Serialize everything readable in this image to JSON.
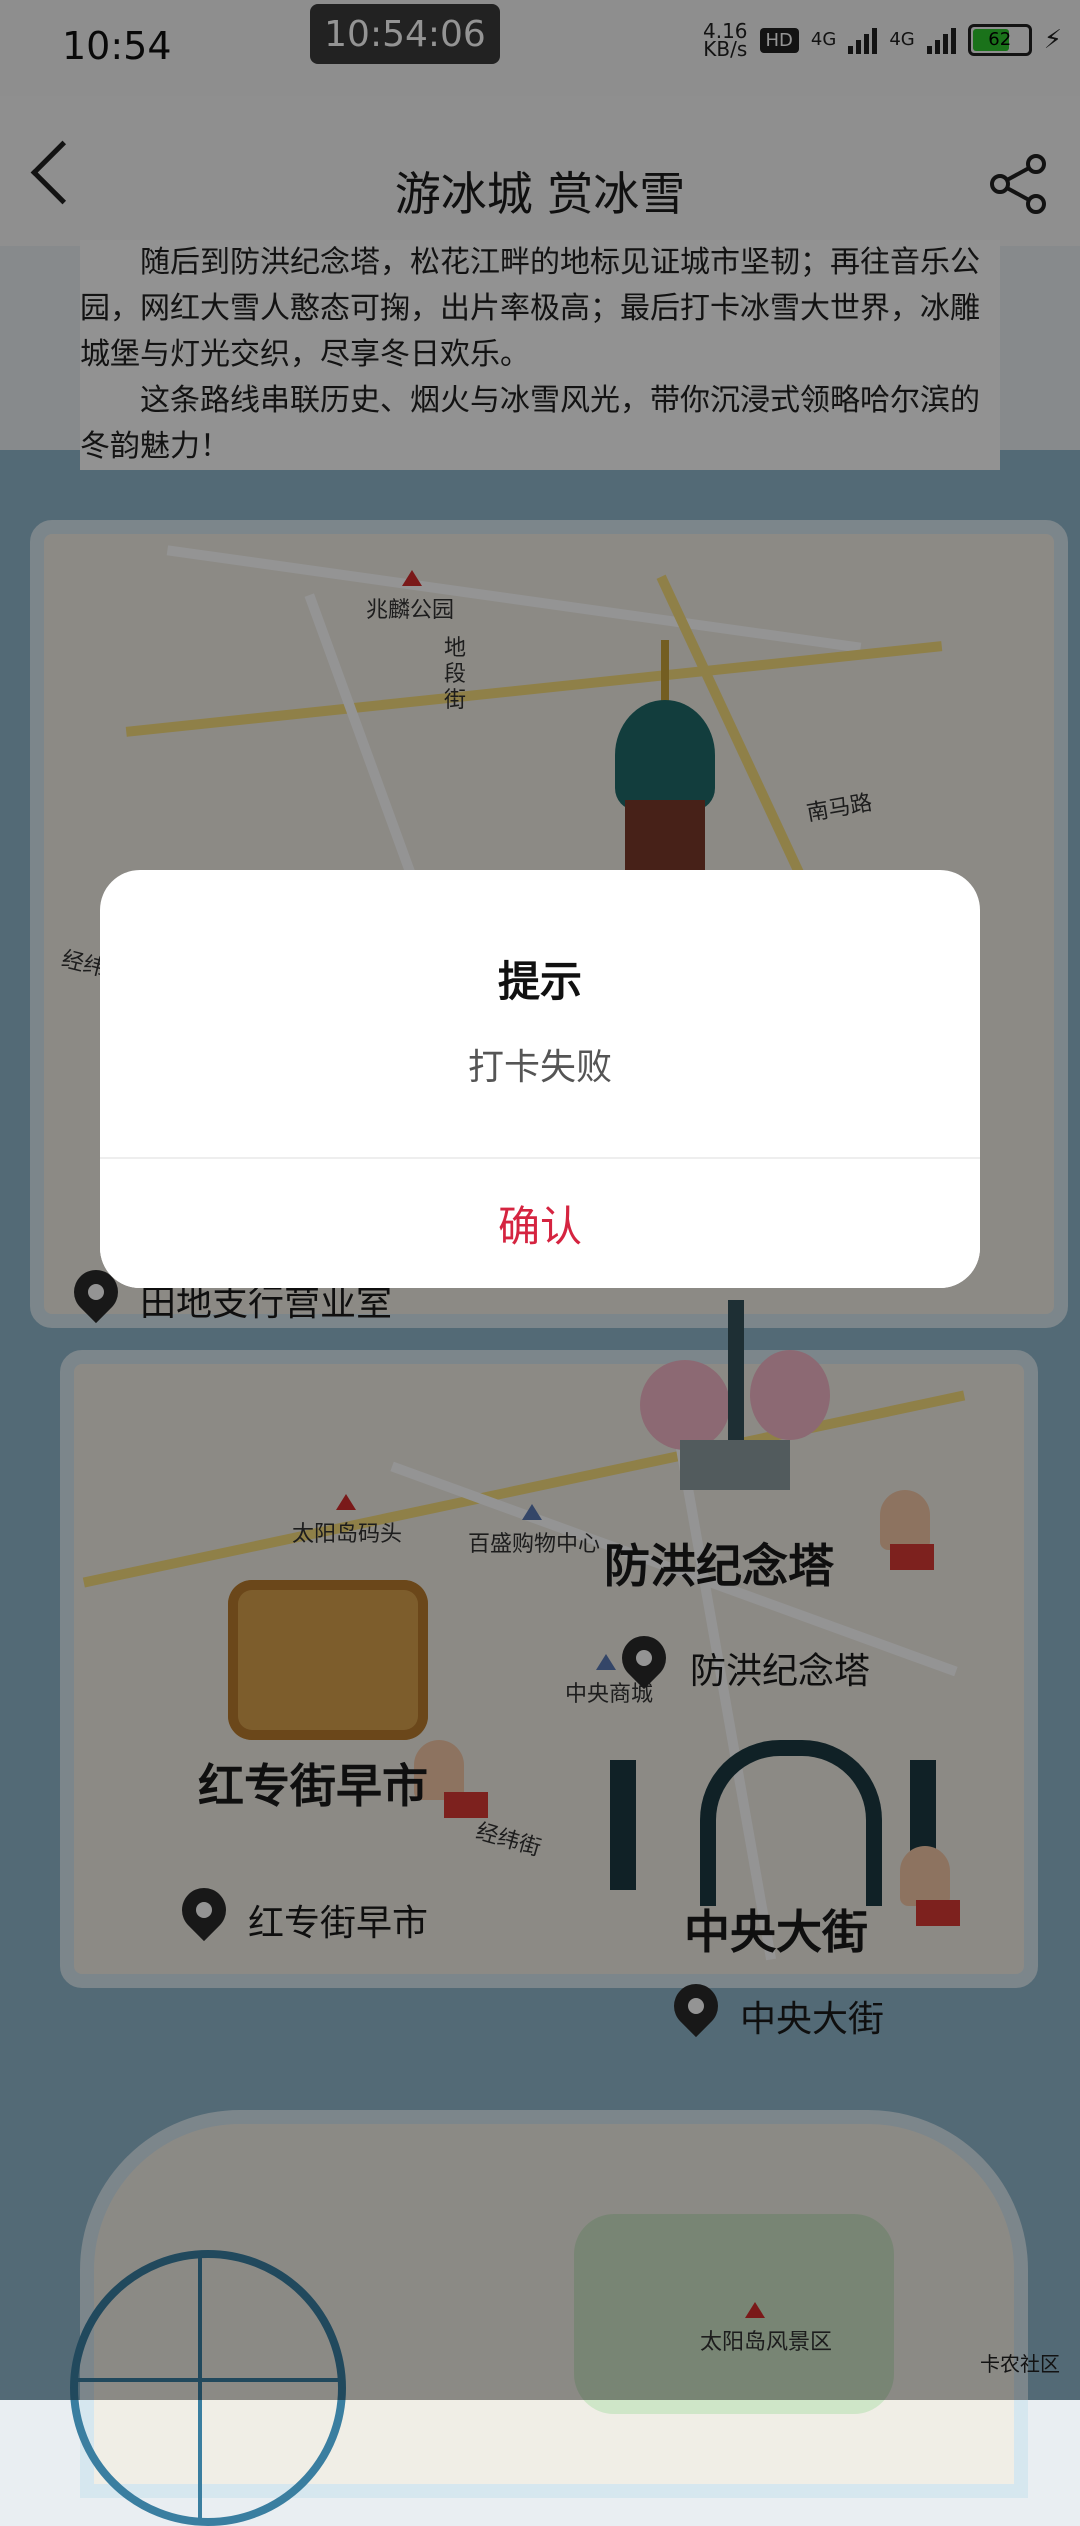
{
  "status_bar": {
    "time": "10:54",
    "clock_overlay": "10:54:06",
    "net_speed_value": "4.16",
    "net_speed_unit": "KB/s",
    "hd_badge": "HD",
    "net1": "4G",
    "net2": "4G",
    "battery": "62"
  },
  "header": {
    "title": "游冰城 赏冰雪"
  },
  "intro": {
    "paragraph1": "随后到防洪纪念塔，松花江畔的地标见证城市坚韧；再往音乐公园，网红大雪人憨态可掬，出片率极高；最后打卡冰雪大世界，冰雕城堡与灯光交织，尽享冬日欢乐。",
    "paragraph2": "这条路线串联历史、烟火与冰雪风光，带你沉浸式领略哈尔滨的冬韵魅力！"
  },
  "map": {
    "labels": {
      "zhaolin_park": "兆麟公园",
      "diduan_street": "地段街",
      "nanma_road": "南马路",
      "jingwei_partial": "经纬",
      "taiyangdao_pier": "太阳岛码头",
      "baisheng_mall": "百盛购物中心",
      "central_mall": "中央商城",
      "jingwei_street": "经纬街",
      "taiyangdao_scenic": "太阳岛风景区"
    },
    "stops": {
      "partial_pin_label": "田地支行营业室",
      "flood_tower_name": "防洪纪念塔",
      "flood_tower_pin": "防洪纪念塔",
      "hongzhuan_name": "红专街早市",
      "hongzhuan_pin": "红专街早市",
      "central_street_name": "中央大街",
      "central_street_pin": "中央大街"
    }
  },
  "watermark": "卡农社区",
  "dialog": {
    "title": "提示",
    "message": "打卡失败",
    "confirm_label": "确认"
  }
}
